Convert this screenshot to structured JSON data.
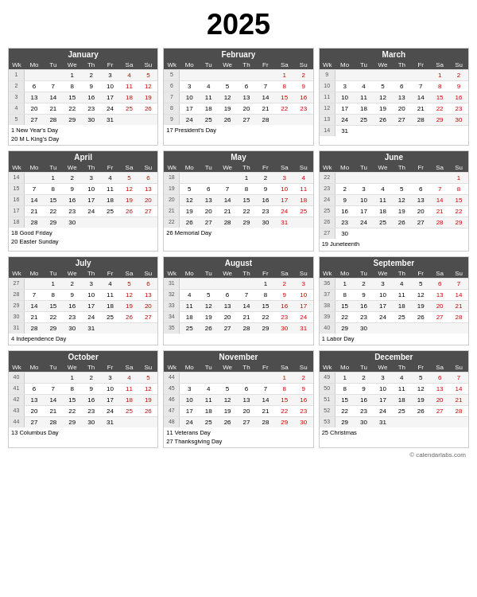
{
  "title": "2025",
  "months": [
    {
      "name": "January",
      "weeks": [
        {
          "wk": 1,
          "days": [
            "",
            "",
            "",
            "1",
            "2",
            "3",
            "4",
            "5"
          ]
        },
        {
          "wk": 2,
          "days": [
            "",
            "6",
            "7",
            "8",
            "9",
            "10",
            "11",
            "12"
          ]
        },
        {
          "wk": 3,
          "days": [
            "",
            "13",
            "14",
            "15",
            "16",
            "17",
            "18",
            "19"
          ]
        },
        {
          "wk": 4,
          "days": [
            "",
            "20",
            "21",
            "22",
            "23",
            "24",
            "25",
            "26"
          ]
        },
        {
          "wk": 5,
          "days": [
            "",
            "27",
            "28",
            "29",
            "30",
            "31",
            "",
            ""
          ]
        }
      ],
      "holidays": [
        "1  New Year's Day",
        "20  M L King's Day"
      ]
    },
    {
      "name": "February",
      "weeks": [
        {
          "wk": 5,
          "days": [
            "",
            "",
            "",
            "",
            "",
            "",
            "1",
            "2"
          ]
        },
        {
          "wk": 6,
          "days": [
            "",
            "3",
            "4",
            "5",
            "6",
            "7",
            "8",
            "9"
          ]
        },
        {
          "wk": 7,
          "days": [
            "",
            "10",
            "11",
            "12",
            "13",
            "14",
            "15",
            "16"
          ]
        },
        {
          "wk": 8,
          "days": [
            "",
            "17",
            "18",
            "19",
            "20",
            "21",
            "22",
            "23"
          ]
        },
        {
          "wk": 9,
          "days": [
            "",
            "24",
            "25",
            "26",
            "27",
            "28",
            "",
            ""
          ]
        }
      ],
      "holidays": [
        "17  President's Day"
      ]
    },
    {
      "name": "March",
      "weeks": [
        {
          "wk": 9,
          "days": [
            "",
            "",
            "",
            "",
            "",
            "",
            "1",
            "2"
          ]
        },
        {
          "wk": 10,
          "days": [
            "",
            "3",
            "4",
            "5",
            "6",
            "7",
            "8",
            "9"
          ]
        },
        {
          "wk": 11,
          "days": [
            "",
            "10",
            "11",
            "12",
            "13",
            "14",
            "15",
            "16"
          ]
        },
        {
          "wk": 12,
          "days": [
            "",
            "17",
            "18",
            "19",
            "20",
            "21",
            "22",
            "23"
          ]
        },
        {
          "wk": 13,
          "days": [
            "",
            "24",
            "25",
            "26",
            "27",
            "28",
            "29",
            "30"
          ]
        },
        {
          "wk": 14,
          "days": [
            "",
            "31",
            "",
            "",
            "",
            "",
            "",
            ""
          ]
        }
      ],
      "holidays": []
    },
    {
      "name": "April",
      "weeks": [
        {
          "wk": 14,
          "days": [
            "",
            "",
            "1",
            "2",
            "3",
            "4",
            "5",
            "6"
          ]
        },
        {
          "wk": 15,
          "days": [
            "",
            "7",
            "8",
            "9",
            "10",
            "11",
            "12",
            "13"
          ]
        },
        {
          "wk": 16,
          "days": [
            "",
            "14",
            "15",
            "16",
            "17",
            "18",
            "19",
            "20"
          ]
        },
        {
          "wk": 17,
          "days": [
            "",
            "21",
            "22",
            "23",
            "24",
            "25",
            "26",
            "27"
          ]
        },
        {
          "wk": 18,
          "days": [
            "",
            "28",
            "29",
            "30",
            "",
            "",
            "",
            ""
          ]
        }
      ],
      "holidays": [
        "18  Good Friday",
        "20  Easter Sunday"
      ]
    },
    {
      "name": "May",
      "weeks": [
        {
          "wk": 18,
          "days": [
            "",
            "",
            "",
            "",
            "1",
            "2",
            "3",
            "4"
          ]
        },
        {
          "wk": 19,
          "days": [
            "",
            "5",
            "6",
            "7",
            "8",
            "9",
            "10",
            "11"
          ]
        },
        {
          "wk": 20,
          "days": [
            "",
            "12",
            "13",
            "14",
            "15",
            "16",
            "17",
            "18"
          ]
        },
        {
          "wk": 21,
          "days": [
            "",
            "19",
            "20",
            "21",
            "22",
            "23",
            "24",
            "25"
          ]
        },
        {
          "wk": 22,
          "days": [
            "",
            "26",
            "27",
            "28",
            "29",
            "30",
            "31",
            ""
          ]
        }
      ],
      "holidays": [
        "26  Memorial Day"
      ]
    },
    {
      "name": "June",
      "weeks": [
        {
          "wk": 22,
          "days": [
            "",
            "",
            "",
            "",
            "",
            "",
            "",
            "1"
          ]
        },
        {
          "wk": 23,
          "days": [
            "",
            "2",
            "3",
            "4",
            "5",
            "6",
            "7",
            "8"
          ]
        },
        {
          "wk": 24,
          "days": [
            "",
            "9",
            "10",
            "11",
            "12",
            "13",
            "14",
            "15"
          ]
        },
        {
          "wk": 25,
          "days": [
            "",
            "16",
            "17",
            "18",
            "19",
            "20",
            "21",
            "22"
          ]
        },
        {
          "wk": 26,
          "days": [
            "",
            "23",
            "24",
            "25",
            "26",
            "27",
            "28",
            "29"
          ]
        },
        {
          "wk": 27,
          "days": [
            "",
            "30",
            "",
            "",
            "",
            "",
            "",
            ""
          ]
        }
      ],
      "holidays": [
        "19  Juneteenth"
      ]
    },
    {
      "name": "July",
      "weeks": [
        {
          "wk": 27,
          "days": [
            "",
            "",
            "1",
            "2",
            "3",
            "4",
            "5",
            "6"
          ]
        },
        {
          "wk": 28,
          "days": [
            "",
            "7",
            "8",
            "9",
            "10",
            "11",
            "12",
            "13"
          ]
        },
        {
          "wk": 29,
          "days": [
            "",
            "14",
            "15",
            "16",
            "17",
            "18",
            "19",
            "20"
          ]
        },
        {
          "wk": 30,
          "days": [
            "",
            "21",
            "22",
            "23",
            "24",
            "25",
            "26",
            "27"
          ]
        },
        {
          "wk": 31,
          "days": [
            "",
            "28",
            "29",
            "30",
            "31",
            "",
            "",
            ""
          ]
        }
      ],
      "holidays": [
        "4  Independence Day"
      ]
    },
    {
      "name": "August",
      "weeks": [
        {
          "wk": 31,
          "days": [
            "",
            "",
            "",
            "",
            "",
            "1",
            "2",
            "3"
          ]
        },
        {
          "wk": 32,
          "days": [
            "",
            "4",
            "5",
            "6",
            "7",
            "8",
            "9",
            "10"
          ]
        },
        {
          "wk": 33,
          "days": [
            "",
            "11",
            "12",
            "13",
            "14",
            "15",
            "16",
            "17"
          ]
        },
        {
          "wk": 34,
          "days": [
            "",
            "18",
            "19",
            "20",
            "21",
            "22",
            "23",
            "24"
          ]
        },
        {
          "wk": 35,
          "days": [
            "",
            "25",
            "26",
            "27",
            "28",
            "29",
            "30",
            "31"
          ]
        }
      ],
      "holidays": []
    },
    {
      "name": "September",
      "weeks": [
        {
          "wk": 36,
          "days": [
            "",
            "1",
            "2",
            "3",
            "4",
            "5",
            "6",
            "7"
          ]
        },
        {
          "wk": 37,
          "days": [
            "",
            "8",
            "9",
            "10",
            "11",
            "12",
            "13",
            "14"
          ]
        },
        {
          "wk": 38,
          "days": [
            "",
            "15",
            "16",
            "17",
            "18",
            "19",
            "20",
            "21"
          ]
        },
        {
          "wk": 39,
          "days": [
            "",
            "22",
            "23",
            "24",
            "25",
            "26",
            "27",
            "28"
          ]
        },
        {
          "wk": 40,
          "days": [
            "",
            "29",
            "30",
            "",
            "",
            "",
            "",
            ""
          ]
        }
      ],
      "holidays": [
        "1  Labor Day"
      ]
    },
    {
      "name": "October",
      "weeks": [
        {
          "wk": 40,
          "days": [
            "",
            "",
            "",
            "1",
            "2",
            "3",
            "4",
            "5"
          ]
        },
        {
          "wk": 41,
          "days": [
            "",
            "6",
            "7",
            "8",
            "9",
            "10",
            "11",
            "12"
          ]
        },
        {
          "wk": 42,
          "days": [
            "",
            "13",
            "14",
            "15",
            "16",
            "17",
            "18",
            "19"
          ]
        },
        {
          "wk": 43,
          "days": [
            "",
            "20",
            "21",
            "22",
            "23",
            "24",
            "25",
            "26"
          ]
        },
        {
          "wk": 44,
          "days": [
            "",
            "27",
            "28",
            "29",
            "30",
            "31",
            "",
            ""
          ]
        }
      ],
      "holidays": [
        "13  Columbus Day"
      ]
    },
    {
      "name": "November",
      "weeks": [
        {
          "wk": 44,
          "days": [
            "",
            "",
            "",
            "",
            "",
            "",
            "1",
            "2"
          ]
        },
        {
          "wk": 45,
          "days": [
            "",
            "3",
            "4",
            "5",
            "6",
            "7",
            "8",
            "9"
          ]
        },
        {
          "wk": 46,
          "days": [
            "",
            "10",
            "11",
            "12",
            "13",
            "14",
            "15",
            "16"
          ]
        },
        {
          "wk": 47,
          "days": [
            "",
            "17",
            "18",
            "19",
            "20",
            "21",
            "22",
            "23"
          ]
        },
        {
          "wk": 48,
          "days": [
            "",
            "24",
            "25",
            "26",
            "27",
            "28",
            "29",
            "30"
          ]
        }
      ],
      "holidays": [
        "11  Veterans Day",
        "27  Thanksgiving Day"
      ]
    },
    {
      "name": "December",
      "weeks": [
        {
          "wk": 49,
          "days": [
            "",
            "1",
            "2",
            "3",
            "4",
            "5",
            "6",
            "7"
          ]
        },
        {
          "wk": 50,
          "days": [
            "",
            "8",
            "9",
            "10",
            "11",
            "12",
            "13",
            "14"
          ]
        },
        {
          "wk": 51,
          "days": [
            "",
            "15",
            "16",
            "17",
            "18",
            "19",
            "20",
            "21"
          ]
        },
        {
          "wk": 52,
          "days": [
            "",
            "22",
            "23",
            "24",
            "25",
            "26",
            "27",
            "28"
          ]
        },
        {
          "wk": 53,
          "days": [
            "",
            "29",
            "30",
            "31",
            "",
            "",
            "",
            ""
          ]
        }
      ],
      "holidays": [
        "25  Christmas"
      ]
    }
  ],
  "dayHeaders": [
    "Wk",
    "Mo",
    "Tu",
    "We",
    "Th",
    "Fr",
    "Sa",
    "Su"
  ],
  "footer": "© calendarlabs.com"
}
